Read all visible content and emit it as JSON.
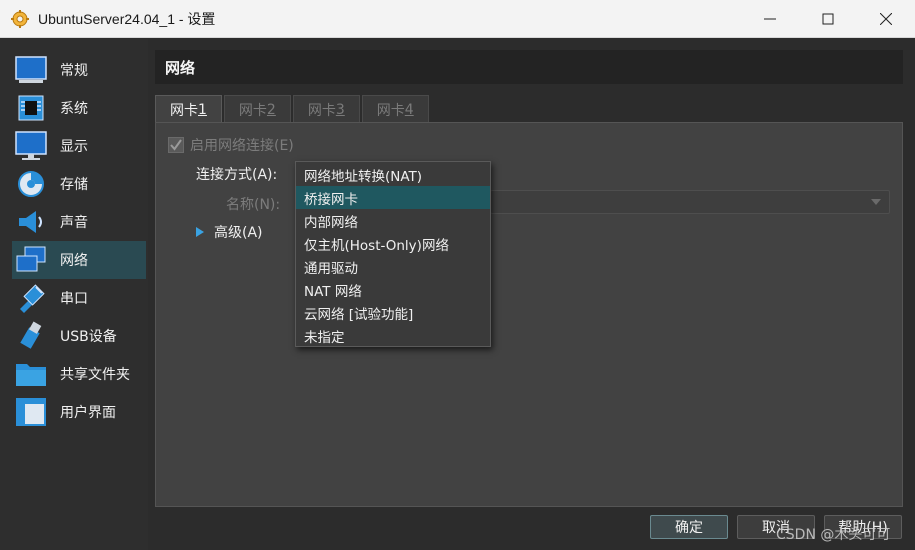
{
  "window": {
    "title": "UbuntuServer24.04_1 - 设置",
    "controls": [
      "minimize-icon",
      "maximize-icon",
      "close-icon"
    ]
  },
  "sidebar": {
    "items": [
      {
        "label": "常规",
        "icon": "general-icon"
      },
      {
        "label": "系统",
        "icon": "chip-icon"
      },
      {
        "label": "显示",
        "icon": "monitor-icon"
      },
      {
        "label": "存储",
        "icon": "disk-icon"
      },
      {
        "label": "声音",
        "icon": "speaker-icon"
      },
      {
        "label": "网络",
        "icon": "network-icon",
        "active": true
      },
      {
        "label": "串口",
        "icon": "serial-port-icon"
      },
      {
        "label": "USB设备",
        "icon": "usb-icon"
      },
      {
        "label": "共享文件夹",
        "icon": "folder-icon"
      },
      {
        "label": "用户界面",
        "icon": "ui-icon"
      }
    ]
  },
  "section": {
    "title": "网络"
  },
  "tabs": [
    {
      "label": "网卡 ",
      "num": "1",
      "active": true
    },
    {
      "label": "网卡 ",
      "num": "2"
    },
    {
      "label": "网卡 ",
      "num": "3"
    },
    {
      "label": "网卡 ",
      "num": "4"
    }
  ],
  "adapter": {
    "enable_label": "启用网络连接(E)",
    "enabled": true,
    "attached_to_label": "连接方式(A):",
    "name_label": "名称(N):",
    "name_value": "",
    "advanced_label": "高级(A)"
  },
  "attached_to_dropdown": {
    "options": [
      "网络地址转换(NAT)",
      "桥接网卡",
      "内部网络",
      "仅主机(Host-Only)网络",
      "通用驱动",
      "NAT 网络",
      "云网络 [试验功能]",
      "未指定"
    ],
    "selected_index": 1
  },
  "buttons": {
    "ok": "确定",
    "cancel": "取消",
    "help": "帮助(H)"
  },
  "watermark": "CSDN @木头可可",
  "colors": {
    "accent": "#3aa3e3",
    "selection": "#1f5860",
    "sidebar_active": "#2a4a52"
  }
}
